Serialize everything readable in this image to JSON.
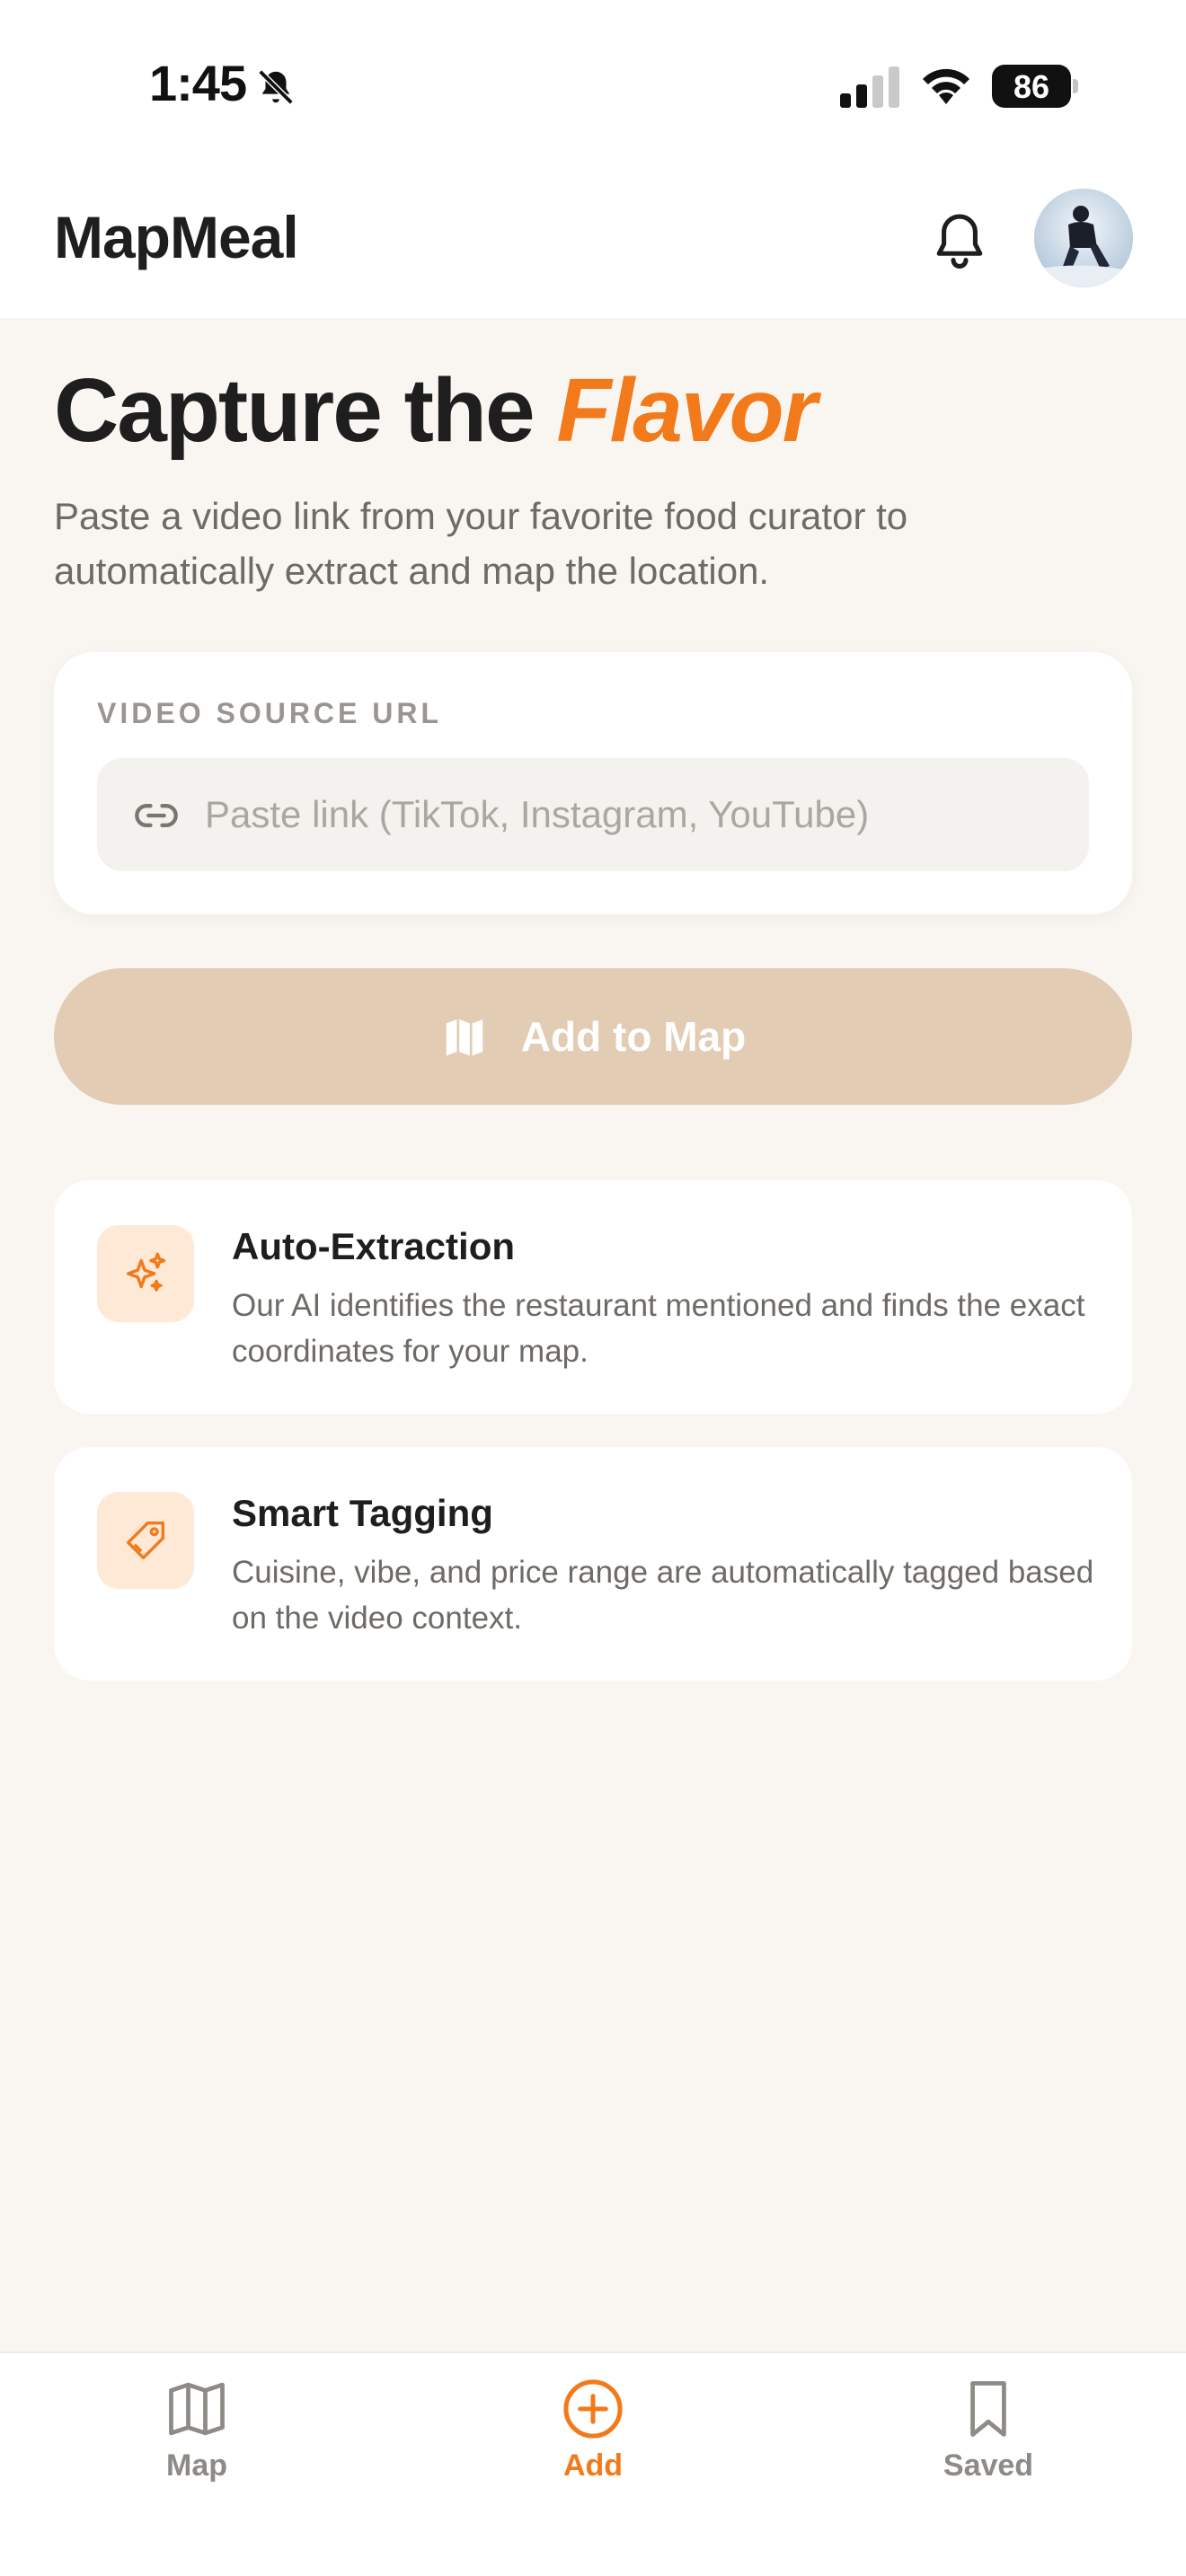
{
  "status_bar": {
    "time": "1:45",
    "battery_level": "86",
    "icons": [
      "bell-slash-icon",
      "cellular-signal-icon",
      "wifi-icon",
      "battery-icon"
    ]
  },
  "header": {
    "app_title": "MapMeal",
    "notification_icon": "bell-icon",
    "avatar": "user-avatar"
  },
  "hero": {
    "title_prefix": "Capture the ",
    "title_accent": "Flavor",
    "subtitle": "Paste a video link from your favorite food curator to automatically extract and map the location."
  },
  "url_card": {
    "label": "VIDEO SOURCE URL",
    "placeholder": "Paste link (TikTok, Instagram, YouTube)",
    "value": "",
    "icon": "link-icon"
  },
  "add_button": {
    "label": "Add to Map",
    "icon": "map-icon",
    "enabled": false
  },
  "features": [
    {
      "title": "Auto-Extraction",
      "description": "Our AI identifies the restaurant mentioned and finds the exact coordinates for your map.",
      "icon": "sparkles-icon"
    },
    {
      "title": "Smart Tagging",
      "description": "Cuisine, vibe, and price range are automatically tagged based on the video context.",
      "icon": "tag-icon"
    }
  ],
  "tab_bar": {
    "active": "Add",
    "tabs": [
      {
        "label": "Map",
        "icon": "map-icon"
      },
      {
        "label": "Add",
        "icon": "plus-circle-icon"
      },
      {
        "label": "Saved",
        "icon": "bookmark-icon"
      }
    ]
  },
  "colors": {
    "accent": "#F27A1A",
    "background": "#F9F6F2",
    "button_disabled": "#E2CCB3",
    "icon_tile": "#FDE9D6"
  }
}
